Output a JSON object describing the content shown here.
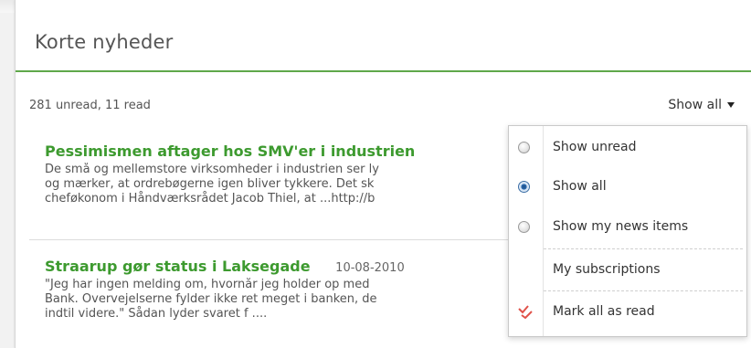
{
  "widget": {
    "title": "Korte nyheder",
    "counts": "281 unread, 11 read",
    "filter_label": "Show all"
  },
  "news": [
    {
      "headline": "Pessimismen aftager hos SMV'er i industrien",
      "date": "",
      "lines": [
        "De små og mellemstore virksomheder i industrien ser ly",
        "og mærker, at ordrebøgerne igen bliver tykkere. Det sk",
        "cheføkonom i Håndværksrådet Jacob Thiel, at ...http://b"
      ]
    },
    {
      "headline": "Straarup gør status i Laksegade",
      "date": "10-08-2010",
      "lines": [
        "\"Jeg har ingen melding om, hvornår jeg holder op med",
        "Bank. Overvejelserne fylder ikke ret meget i banken, de",
        "indtil videre.\" Sådan lyder svaret f ...."
      ]
    }
  ],
  "dropdown": {
    "items": [
      {
        "label": "Show unread",
        "type": "radio",
        "checked": false
      },
      {
        "label": "Show all",
        "type": "radio",
        "checked": true
      },
      {
        "label": "Show my news items",
        "type": "radio",
        "checked": false
      },
      {
        "label": "My subscriptions",
        "type": "link"
      },
      {
        "label": "Mark all as read",
        "type": "action",
        "icon": "mark-read-icon"
      }
    ]
  },
  "colors": {
    "accent_green": "#3d9a2f",
    "rule_green": "#5fa84a",
    "mark_read_icon": "#e0524a"
  }
}
